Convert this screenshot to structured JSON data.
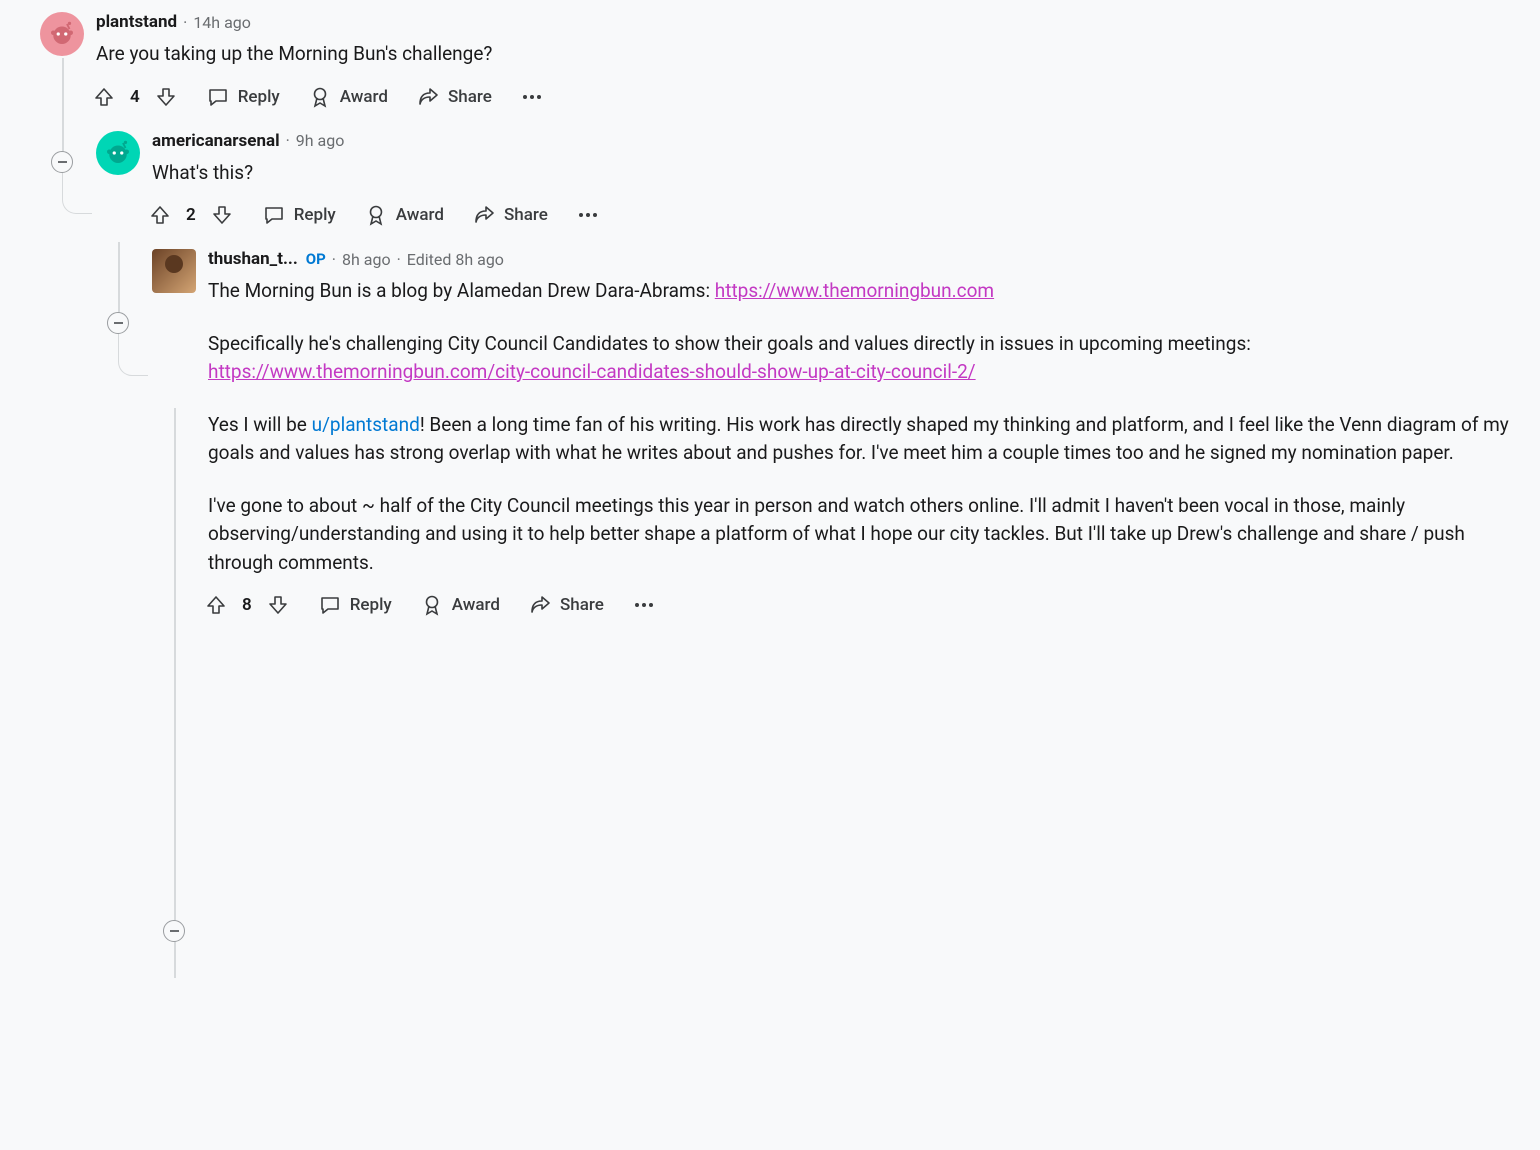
{
  "actions": {
    "reply": "Reply",
    "award": "Award",
    "share": "Share"
  },
  "comments": [
    {
      "username": "plantstand",
      "timestamp": "14h ago",
      "body_text": "Are you taking up the Morning Bun's challenge?",
      "votes": "4"
    },
    {
      "username": "americanarsenal",
      "timestamp": "9h ago",
      "body_text": "What's this?",
      "votes": "2"
    },
    {
      "username": "thushan_t...",
      "op_label": "OP",
      "timestamp": "8h ago",
      "edited": "Edited 8h ago",
      "p1_pre": "The Morning Bun is a blog by Alamedan Drew Dara-Abrams: ",
      "p1_link": "https://www.themorningbun.com",
      "p2_pre": "Specifically he's challenging City Council Candidates to show their goals and values directly in issues in upcoming meetings: ",
      "p2_link": "https://www.themorningbun.com/city-council-candidates-should-show-up-at-city-council-2/",
      "p3_pre": "Yes I will be ",
      "p3_user": "u/plantstand",
      "p3_post": "! Been a long time fan of his writing. His work has directly shaped my thinking and platform, and I feel like the Venn diagram of my goals and values has strong overlap with what he writes about and pushes for. I've meet him a couple times too and he signed my nomination paper.",
      "p4": "I've gone to about ~ half of the City Council meetings this year in person and watch others online. I'll admit I haven't been vocal in those, mainly observing/understanding and using it to help better shape a platform of what I hope our city tackles. But I'll take up Drew's challenge and share / push through comments.",
      "votes": "8"
    }
  ]
}
